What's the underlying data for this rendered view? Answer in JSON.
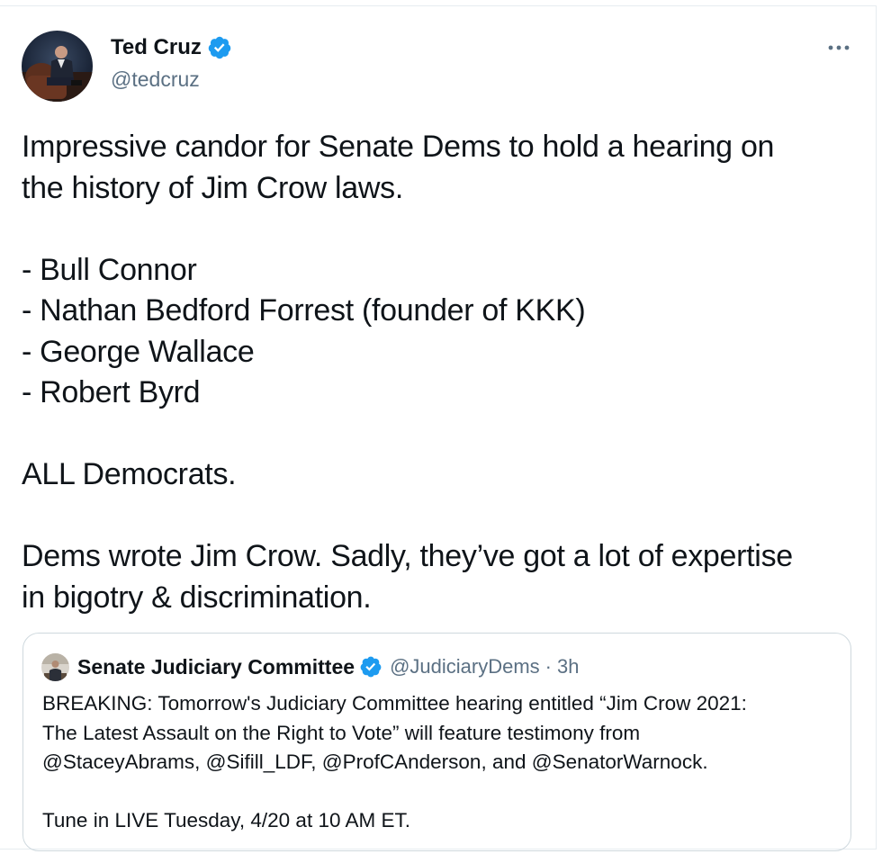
{
  "tweet": {
    "author": {
      "name": "Ted Cruz",
      "handle": "@tedcruz",
      "verified": true
    },
    "text_lines": [
      "Impressive candor for Senate Dems to hold a hearing on",
      "the history of Jim Crow laws.",
      "",
      "- Bull Connor",
      "- Nathan Bedford Forrest (founder of KKK)",
      "- George Wallace",
      "- Robert Byrd",
      "",
      "ALL Democrats.",
      "",
      "Dems wrote Jim Crow. Sadly, they’ve got a lot of expertise",
      "in bigotry & discrimination."
    ],
    "more_icon": "more-horizontal-icon"
  },
  "quoted_tweet": {
    "author": {
      "name": "Senate Judiciary Committee",
      "handle": "@JudiciaryDems",
      "verified": true
    },
    "separator": "·",
    "time": "3h",
    "text_lines": [
      "BREAKING: Tomorrow's Judiciary Committee hearing entitled “Jim Crow 2021:",
      "The Latest Assault on the Right to Vote” will feature testimony from",
      "@StaceyAbrams, @Sifill_LDF, @ProfCAnderson, and @SenatorWarnock.",
      "",
      "Tune in LIVE Tuesday, 4/20 at 10 AM ET."
    ]
  },
  "colors": {
    "verified_blue": "#1d9bf0",
    "secondary_text": "#5b7083",
    "primary_text": "#0f1419",
    "border": "#cfd9de"
  }
}
